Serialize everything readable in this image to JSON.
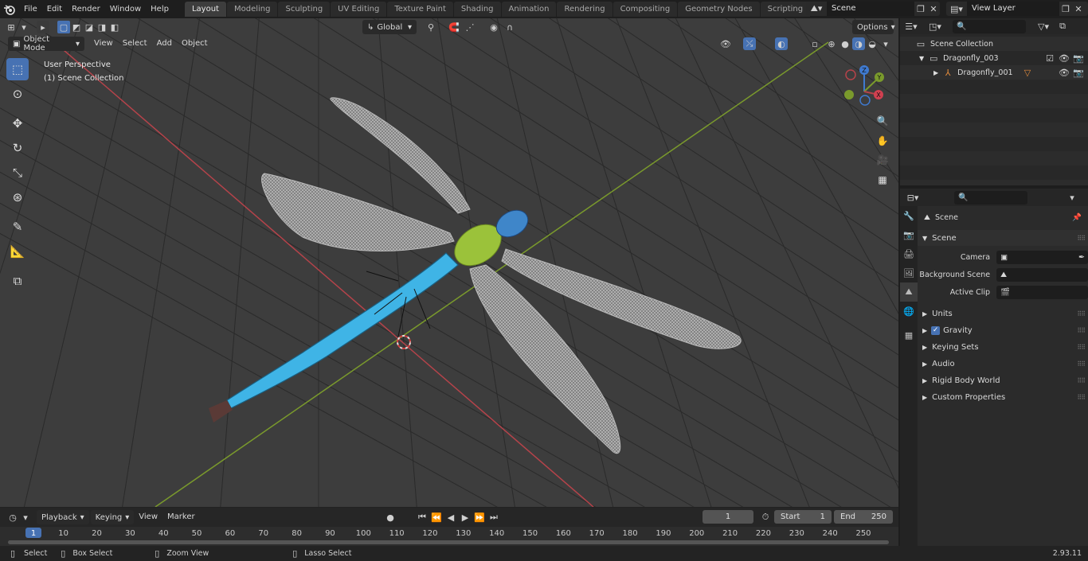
{
  "menu": [
    "File",
    "Edit",
    "Render",
    "Window",
    "Help"
  ],
  "workspaces": [
    {
      "label": "Layout",
      "active": true
    },
    {
      "label": "Modeling"
    },
    {
      "label": "Sculpting"
    },
    {
      "label": "UV Editing"
    },
    {
      "label": "Texture Paint"
    },
    {
      "label": "Shading"
    },
    {
      "label": "Animation"
    },
    {
      "label": "Rendering"
    },
    {
      "label": "Compositing"
    },
    {
      "label": "Geometry Nodes"
    },
    {
      "label": "Scripting"
    }
  ],
  "add_workspace": "+",
  "scene_name": "Scene",
  "view_layer": "View Layer",
  "viewport": {
    "mode": "Object Mode",
    "menu": [
      "View",
      "Select",
      "Add",
      "Object"
    ],
    "orientation": "Global",
    "options": "Options",
    "perspective_label": "User Perspective",
    "collection_label": "(1) Scene Collection",
    "gizmo_axes": {
      "x": "X",
      "y": "Y",
      "z": "Z"
    }
  },
  "outliner": {
    "root": "Scene Collection",
    "collection": "Dragonfly_003",
    "object": "Dragonfly_001"
  },
  "properties": {
    "context": "Scene",
    "panel_title": "Scene",
    "fields": [
      {
        "label": "Camera",
        "value": ""
      },
      {
        "label": "Background Scene",
        "value": ""
      },
      {
        "label": "Active Clip",
        "value": ""
      }
    ],
    "panels": [
      "Units",
      "Gravity",
      "Keying Sets",
      "Audio",
      "Rigid Body World",
      "Custom Properties"
    ],
    "gravity_checked": true
  },
  "timeline": {
    "menu": [
      "Playback",
      "Keying",
      "View",
      "Marker"
    ],
    "current_frame": "1",
    "start_label": "Start",
    "start": "1",
    "end_label": "End",
    "end": "250",
    "ticks": [
      "1",
      "10",
      "20",
      "30",
      "40",
      "50",
      "60",
      "70",
      "80",
      "90",
      "100",
      "110",
      "120",
      "130",
      "140",
      "150",
      "160",
      "170",
      "180",
      "190",
      "200",
      "210",
      "220",
      "230",
      "240",
      "250"
    ]
  },
  "statusbar": {
    "select": "Select",
    "box_select": "Box Select",
    "zoom_view": "Zoom View",
    "lasso_select": "Lasso Select",
    "version": "2.93.11"
  },
  "colors": {
    "accent": "#4772b3",
    "x_axis": "#b5434a",
    "y_axis": "#7a9a2c",
    "z_axis": "#3f7ad0",
    "dragonfly_body": "#3fb4e6",
    "dragonfly_thorax": "#9bc23a"
  }
}
